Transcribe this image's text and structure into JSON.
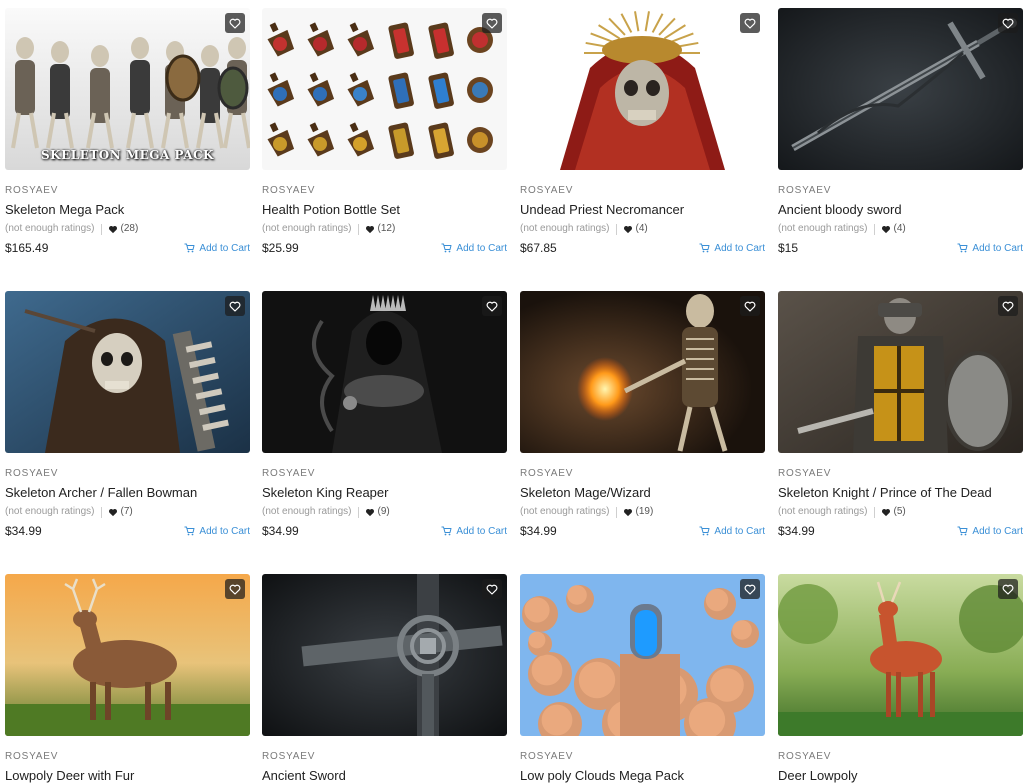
{
  "colors": {
    "accent": "#3a8fd6",
    "text": "#212121",
    "muted": "#9a9a9a",
    "publisher": "#7a7a7a"
  },
  "products": [
    {
      "publisher": "ROSYAEV",
      "title": "Skeleton Mega Pack",
      "rating": "(not enough ratings)",
      "likes": "(28)",
      "price": "$165.49",
      "cart": "Add to Cart",
      "image_caption": "SKELETON MEGA PACK",
      "art": "skeletons"
    },
    {
      "publisher": "ROSYAEV",
      "title": "Health Potion Bottle Set",
      "rating": "(not enough ratings)",
      "likes": "(12)",
      "price": "$25.99",
      "cart": "Add to Cart",
      "image_caption": "",
      "art": "potions"
    },
    {
      "publisher": "ROSYAEV",
      "title": "Undead Priest Necromancer",
      "rating": "(not enough ratings)",
      "likes": "(4)",
      "price": "$67.85",
      "cart": "Add to Cart",
      "image_caption": "",
      "art": "priest"
    },
    {
      "publisher": "ROSYAEV",
      "title": "Ancient bloody sword",
      "rating": "(not enough ratings)",
      "likes": "(4)",
      "price": "$15",
      "cart": "Add to Cart",
      "image_caption": "",
      "art": "sword"
    },
    {
      "publisher": "ROSYAEV",
      "title": "Skeleton Archer / Fallen Bowman",
      "rating": "(not enough ratings)",
      "likes": "(7)",
      "price": "$34.99",
      "cart": "Add to Cart",
      "image_caption": "",
      "art": "archer"
    },
    {
      "publisher": "ROSYAEV",
      "title": "Skeleton King Reaper",
      "rating": "(not enough ratings)",
      "likes": "(9)",
      "price": "$34.99",
      "cart": "Add to Cart",
      "image_caption": "",
      "art": "reaper"
    },
    {
      "publisher": "ROSYAEV",
      "title": "Skeleton Mage/Wizard",
      "rating": "(not enough ratings)",
      "likes": "(19)",
      "price": "$34.99",
      "cart": "Add to Cart",
      "image_caption": "",
      "art": "mage"
    },
    {
      "publisher": "ROSYAEV",
      "title": "Skeleton Knight / Prince of The Dead",
      "rating": "(not enough ratings)",
      "likes": "(5)",
      "price": "$34.99",
      "cart": "Add to Cart",
      "image_caption": "",
      "art": "knight"
    },
    {
      "publisher": "ROSYAEV",
      "title": "Lowpoly Deer with Fur",
      "rating": "",
      "likes": "",
      "price": "",
      "cart": "",
      "image_caption": "",
      "art": "deer-fur"
    },
    {
      "publisher": "ROSYAEV",
      "title": "Ancient Sword",
      "rating": "",
      "likes": "",
      "price": "",
      "cart": "",
      "image_caption": "",
      "art": "ancient-sword"
    },
    {
      "publisher": "ROSYAEV",
      "title": "Low poly Clouds Mega Pack",
      "rating": "",
      "likes": "",
      "price": "",
      "cart": "",
      "image_caption": "",
      "art": "clouds"
    },
    {
      "publisher": "ROSYAEV",
      "title": "Deer Lowpoly",
      "rating": "",
      "likes": "",
      "price": "",
      "cart": "",
      "image_caption": "",
      "art": "deer-lowpoly"
    }
  ]
}
